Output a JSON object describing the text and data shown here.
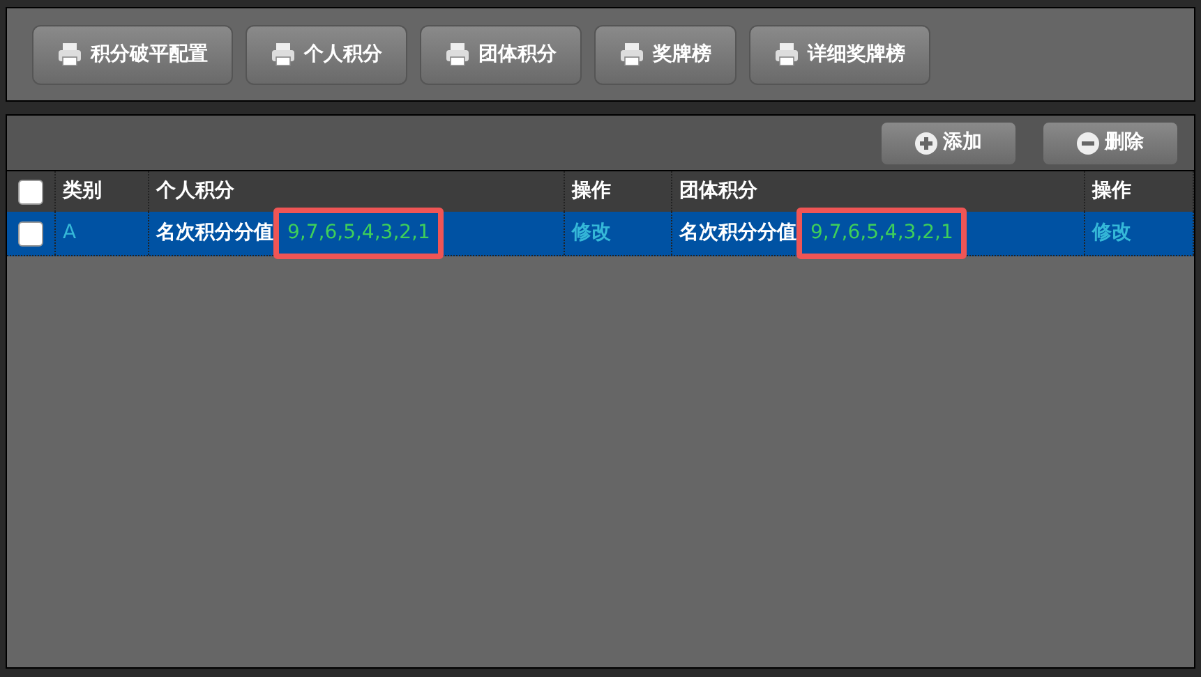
{
  "toolbar": [
    {
      "label": "积分破平配置"
    },
    {
      "label": "个人积分"
    },
    {
      "label": "团体积分"
    },
    {
      "label": "奖牌榜"
    },
    {
      "label": "详细奖牌榜"
    }
  ],
  "actions": [
    {
      "kind": "add",
      "label": "添加"
    },
    {
      "kind": "remove",
      "label": "删除"
    }
  ],
  "table": {
    "select_all_checked": false,
    "columns": [
      "类别",
      "个人积分",
      "操作",
      "团体积分",
      "操作"
    ],
    "rows": [
      {
        "selected": true,
        "checked": false,
        "category": "A",
        "personal": {
          "label": "名次积分分值",
          "value": "9,7,6,5,4,3,2,1",
          "highlighted": true
        },
        "personal_action": "修改",
        "team": {
          "label": "名次积分分值",
          "value": "9,7,6,5,4,3,2,1",
          "highlighted": true
        },
        "team_action": "修改"
      }
    ]
  }
}
